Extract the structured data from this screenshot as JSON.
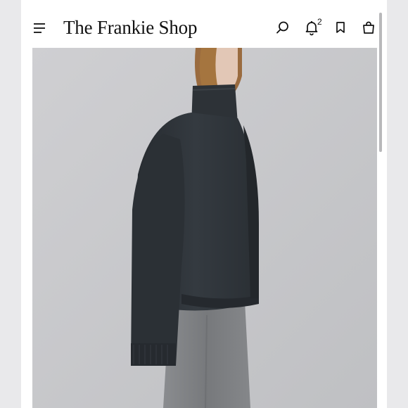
{
  "header": {
    "brand": "The Frankie Shop",
    "notification_count": "2"
  },
  "icons": {
    "menu": "hamburger-menu-icon",
    "search": "search-icon",
    "notifications": "bell-icon",
    "saved": "bookmark-icon",
    "cart": "shopping-bag-icon"
  },
  "colors": {
    "sweater": "#2e3338",
    "trousers": "#7d7f82",
    "backdrop": "#c9c9cc"
  }
}
